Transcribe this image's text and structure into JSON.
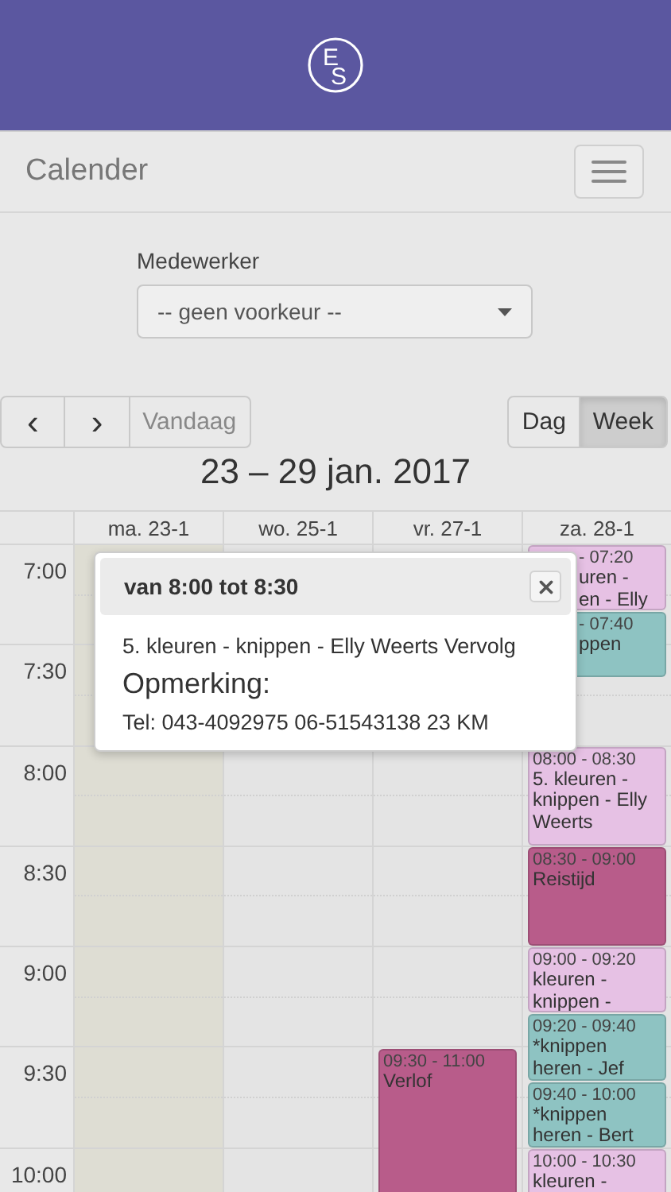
{
  "header": {
    "logo": {
      "letters": [
        "E",
        "S"
      ]
    }
  },
  "navbar": {
    "title": "Calender"
  },
  "filter": {
    "label": "Medewerker",
    "value": "-- geen voorkeur --"
  },
  "toolbar": {
    "nav": [
      {
        "label": "‹",
        "kind": "prev"
      },
      {
        "label": "›",
        "kind": "next"
      },
      {
        "label": "Vandaag",
        "kind": "today",
        "disabled": true
      }
    ],
    "views": [
      {
        "label": "Dag",
        "selected": false
      },
      {
        "label": "Week",
        "selected": true
      }
    ]
  },
  "range_title": "23 – 29 jan. 2017",
  "calendar": {
    "days": [
      {
        "label": "ma. 23-1",
        "today": true
      },
      {
        "label": "wo. 25-1",
        "today": false
      },
      {
        "label": "vr. 27-1",
        "today": false,
        "events": [
          {
            "time": "09:30 - 11:00",
            "lines": [
              "Verlof"
            ],
            "color": "#b85c8a",
            "covered": false
          }
        ]
      },
      {
        "label": "za. 28-1",
        "today": false,
        "events": [
          {
            "time": "- 07:20",
            "lines": [
              "uren -",
              "en - Elly"
            ],
            "color": "#e6c1e4",
            "covered": true
          },
          {
            "time": "- 07:40",
            "lines": [
              "ppen"
            ],
            "color": "#8ec3c2",
            "covered": true
          },
          {
            "time": "08:00 - 08:30",
            "lines": [
              "5. kleuren -",
              "knippen - Elly",
              "Weerts"
            ],
            "color": "#e6c1e4",
            "covered": false
          },
          {
            "time": "08:30 - 09:00",
            "lines": [
              "Reistijd"
            ],
            "color": "#b85c8a",
            "covered": false
          },
          {
            "time": "09:00 - 09:20",
            "lines": [
              "kleuren -",
              "knippen -"
            ],
            "color": "#e6c1e4",
            "covered": false
          },
          {
            "time": "09:20 - 09:40",
            "lines": [
              "*knippen",
              "heren - Jef"
            ],
            "color": "#8ec3c2",
            "covered": false
          },
          {
            "time": "09:40 - 10:00",
            "lines": [
              "*knippen",
              "heren - Bert"
            ],
            "color": "#8ec3c2",
            "covered": false
          },
          {
            "time": "10:00 - 10:30",
            "lines": [
              "kleuren -"
            ],
            "color": "#e6c1e4",
            "covered": false
          }
        ]
      }
    ],
    "times": [
      "7:00",
      "7:30",
      "8:00",
      "8:30",
      "9:00",
      "9:30",
      "10:00"
    ]
  },
  "popover": {
    "title": "van 8:00 tot 8:30",
    "description": "5. kleuren - knippen - Elly Weerts Vervolg",
    "heading": "Opmerking:",
    "note": "Tel: 043-4092975 06-51543138 23 KM"
  }
}
